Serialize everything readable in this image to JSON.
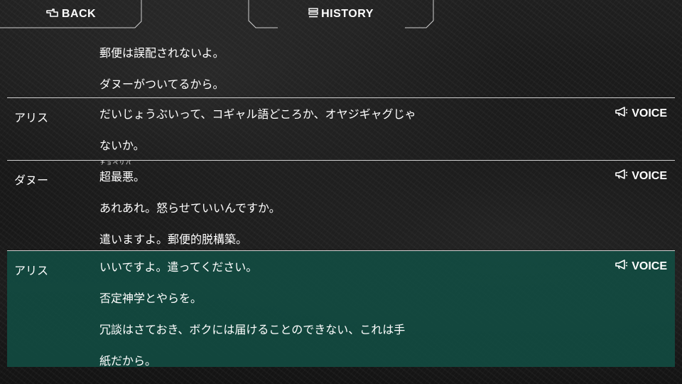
{
  "nav": {
    "back_label": "BACK",
    "history_label": "HISTORY"
  },
  "voice_label": "VOICE",
  "entries": [
    {
      "speaker": "",
      "lines": [
        "郵便は誤配されないよ。",
        "ダヌーがついてるから。"
      ],
      "voice": false,
      "selected": false
    },
    {
      "speaker": "アリス",
      "lines": [
        "だいじょうぶいって、コギャル語どころか、オヤジギャグじゃ",
        "ないか。"
      ],
      "voice": true,
      "selected": false
    },
    {
      "speaker": "ダヌー",
      "ruby": "チョベリバ",
      "lines": [
        "超最悪。",
        "あれあれ。怒らせていいんですか。",
        "遣いますよ。郵便的脱構築。"
      ],
      "voice": true,
      "selected": false
    },
    {
      "speaker": "アリス",
      "lines": [
        "いいですよ。遣ってください。",
        "否定神学とやらを。",
        "冗談はさておき、ボクには届けることのできない、これは手",
        "紙だから。"
      ],
      "voice": true,
      "selected": true
    }
  ],
  "colors": {
    "selected_bg": "#124e44",
    "divider": "#cfcfcf",
    "text": "#ffffff"
  },
  "icons": {
    "back": "hand-pointer-back-icon",
    "history": "history-list-icon",
    "voice": "megaphone-icon"
  }
}
